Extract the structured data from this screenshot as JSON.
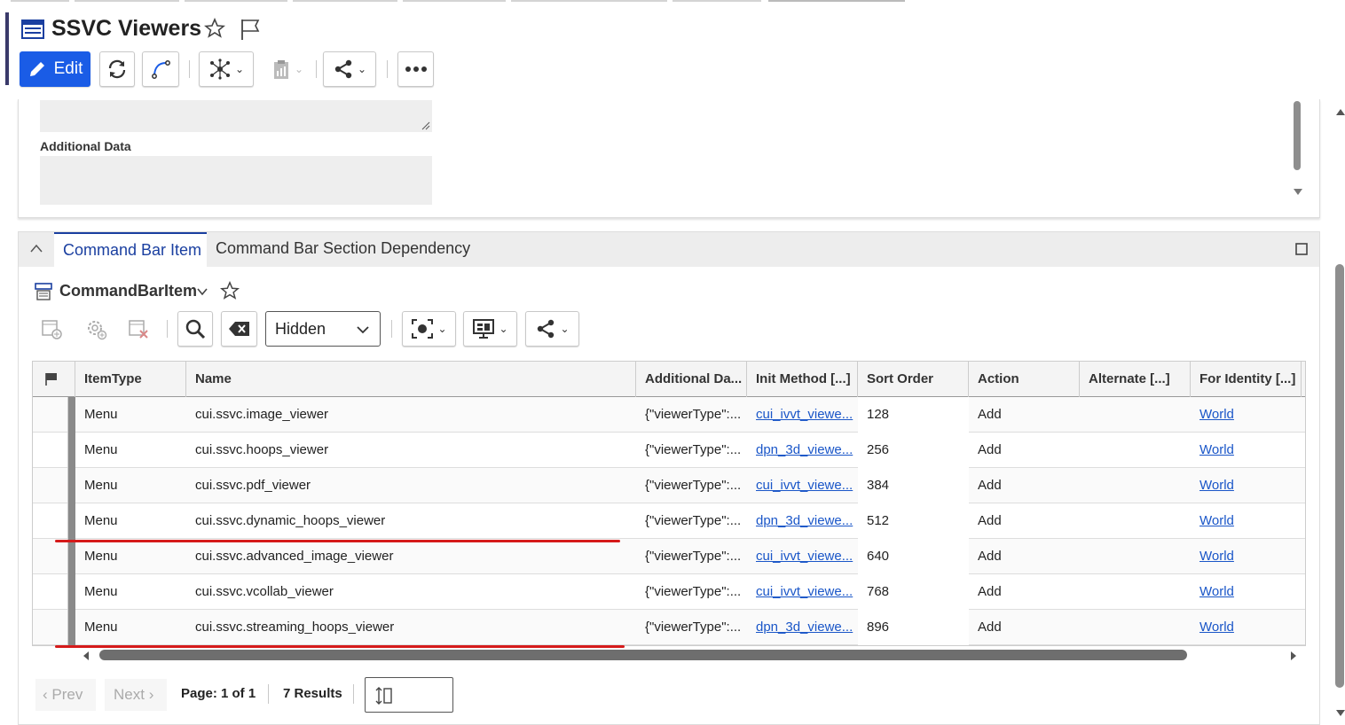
{
  "header": {
    "title": "SSVC Viewers",
    "edit_label": "Edit",
    "accent": "#1a5ce6"
  },
  "form": {
    "additional_data_label": "Additional Data"
  },
  "tabs": [
    {
      "label": "Command Bar Item",
      "active": true
    },
    {
      "label": "Command Bar Section Dependency",
      "active": false
    }
  ],
  "sub_toolbar": {
    "title": "CommandBarItem",
    "filter_value": "Hidden"
  },
  "grid": {
    "columns": [
      "ItemType",
      "Name",
      "Additional Da...",
      "Init Method [...]",
      "Sort Order",
      "Action",
      "Alternate [...]",
      "For Identity [...]"
    ],
    "rows": [
      {
        "item_type": "Menu",
        "name": "cui.ssvc.image_viewer",
        "additional": "{\"viewerType\":...",
        "init": "cui_ivvt_viewe...",
        "sort": "128",
        "action": "Add",
        "alternate": "",
        "identity": "World"
      },
      {
        "item_type": "Menu",
        "name": "cui.ssvc.hoops_viewer",
        "additional": "{\"viewerType\":...",
        "init": "dpn_3d_viewe...",
        "sort": "256",
        "action": "Add",
        "alternate": "",
        "identity": "World"
      },
      {
        "item_type": "Menu",
        "name": "cui.ssvc.pdf_viewer",
        "additional": "{\"viewerType\":...",
        "init": "cui_ivvt_viewe...",
        "sort": "384",
        "action": "Add",
        "alternate": "",
        "identity": "World"
      },
      {
        "item_type": "Menu",
        "name": "cui.ssvc.dynamic_hoops_viewer",
        "additional": "{\"viewerType\":...",
        "init": "dpn_3d_viewe...",
        "sort": "512",
        "action": "Add",
        "alternate": "",
        "identity": "World"
      },
      {
        "item_type": "Menu",
        "name": "cui.ssvc.advanced_image_viewer",
        "additional": "{\"viewerType\":...",
        "init": "cui_ivvt_viewe...",
        "sort": "640",
        "action": "Add",
        "alternate": "",
        "identity": "World"
      },
      {
        "item_type": "Menu",
        "name": "cui.ssvc.vcollab_viewer",
        "additional": "{\"viewerType\":...",
        "init": "cui_ivvt_viewe...",
        "sort": "768",
        "action": "Add",
        "alternate": "",
        "identity": "World"
      },
      {
        "item_type": "Menu",
        "name": "cui.ssvc.streaming_hoops_viewer",
        "additional": "{\"viewerType\":...",
        "init": "dpn_3d_viewe...",
        "sort": "896",
        "action": "Add",
        "alternate": "",
        "identity": "World"
      }
    ]
  },
  "pager": {
    "prev_label": "Prev",
    "next_label": "Next",
    "page_label": "Page: 1 of 1",
    "results_label": "7 Results"
  },
  "annotation_color": "#d51a1a"
}
